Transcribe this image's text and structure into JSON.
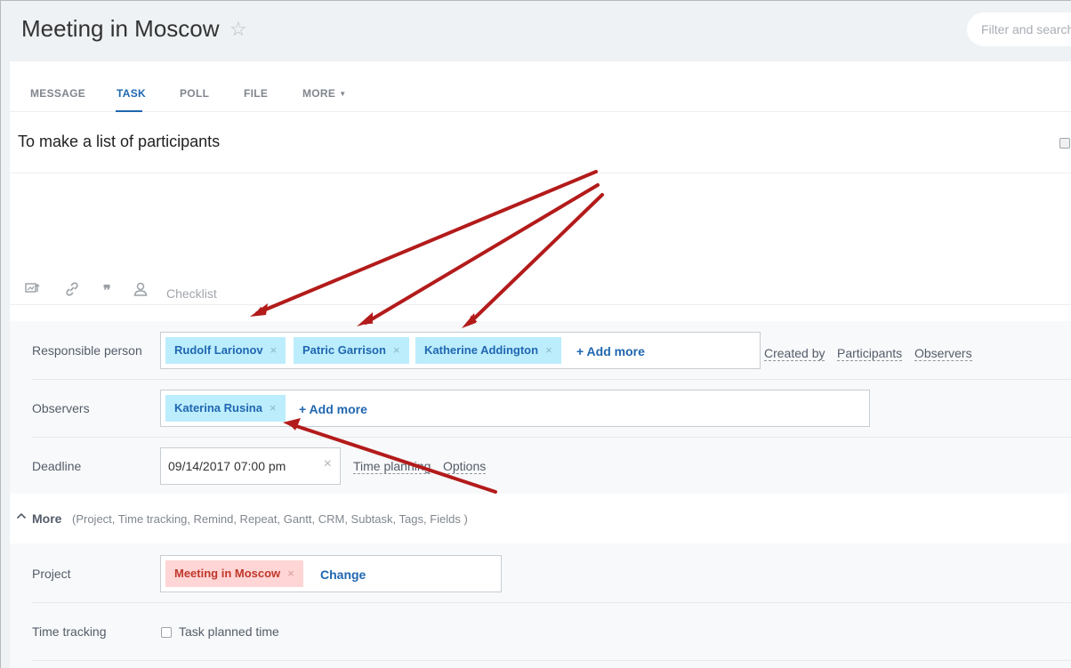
{
  "header": {
    "title": "Meeting in Moscow",
    "search_placeholder": "Filter and search"
  },
  "tabs": [
    {
      "label": "MESSAGE"
    },
    {
      "label": "TASK"
    },
    {
      "label": "POLL"
    },
    {
      "label": "FILE"
    },
    {
      "label": "MORE"
    }
  ],
  "task": {
    "title": "To make a list of participants",
    "checklist_label": "Checklist"
  },
  "responsible": {
    "label": "Responsible person",
    "people": [
      "Rudolf Larionov",
      "Patric Garrison",
      "Katherine Addington"
    ],
    "add_more": "+ Add more",
    "links": [
      "Created by",
      "Participants",
      "Observers"
    ]
  },
  "observers": {
    "label": "Observers",
    "people": [
      "Katerina Rusina"
    ],
    "add_more": "+ Add more"
  },
  "deadline": {
    "label": "Deadline",
    "value": "09/14/2017 07:00 pm",
    "time_planning": "Time planning",
    "options": "Options"
  },
  "more": {
    "label": "More",
    "list": "(Project,  Time tracking,  Remind,  Repeat,  Gantt,  CRM,  Subtask,  Tags,  Fields )"
  },
  "project": {
    "label": "Project",
    "value": "Meeting in Moscow",
    "change": "Change"
  },
  "time_tracking": {
    "label": "Time tracking",
    "checkbox_label": "Task planned time"
  },
  "colors": {
    "accent": "#2067b0",
    "chip_blue": "#bcedfc",
    "chip_red": "#ffd5d5",
    "arrow": "#b31b1b"
  }
}
